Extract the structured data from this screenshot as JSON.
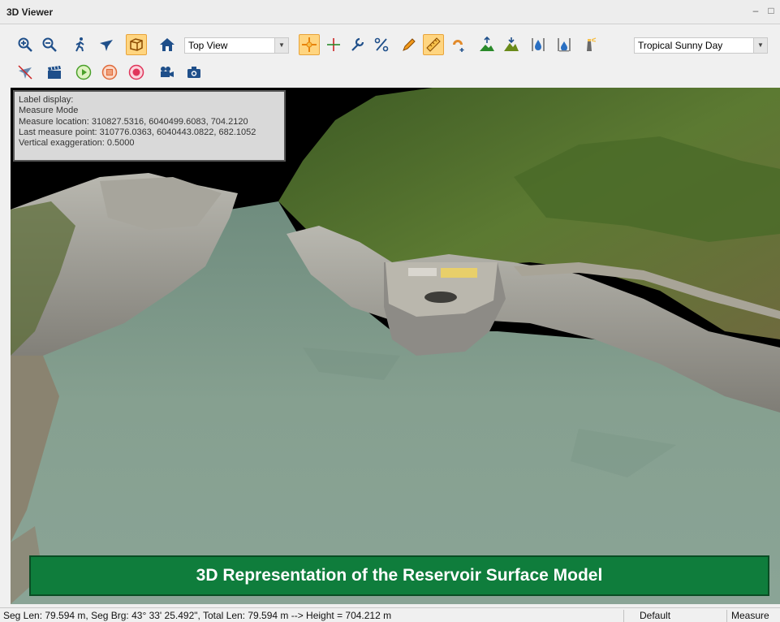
{
  "window": {
    "title": "3D Viewer",
    "minimize_glyph": "–",
    "maximize_glyph": "□"
  },
  "toolbar": {
    "view_select": "Top View",
    "sky_select": "Tropical Sunny Day",
    "icons": [
      "zoom-in-icon",
      "zoom-out-icon",
      "walk-icon",
      "fly-icon",
      "3d-box-icon",
      "home-icon",
      "crosshair-icon",
      "plus-icon",
      "wrench-icon",
      "percent-slope-icon",
      "pencil-icon",
      "ruler-icon",
      "magnet-icon",
      "raise-terrain-icon",
      "lower-terrain-icon",
      "water-level-up-icon",
      "water-level-down-icon",
      "lighthouse-icon",
      "no-fly-icon",
      "clapper-icon",
      "play-icon",
      "stop-icon",
      "record-icon",
      "video-camera-icon",
      "photo-camera-icon"
    ],
    "active": [
      "3d-box-icon",
      "crosshair-icon",
      "ruler-icon"
    ]
  },
  "info": {
    "line1": "Label display:",
    "line2": "Measure Mode",
    "line3": "Measure location: 310827.5316, 6040499.6083, 704.2120",
    "line4": "Last measure point: 310776.0363, 6040443.0822, 682.1052",
    "line5": "Vertical exaggeration: 0.5000"
  },
  "banner": "3D Representation of the Reservoir Surface Model",
  "status": {
    "measure": "Seg Len: 79.594 m, Seg Brg: 43° 33' 25.492\", Total Len: 79.594 m --> Height = 704.212 m",
    "profile": "Default",
    "mode": "Measure"
  },
  "colors": {
    "banner": "#0f7d3c",
    "water": "#7d9a8a",
    "vegetation": "#4f6b2a",
    "active_button": "#ffd580"
  }
}
